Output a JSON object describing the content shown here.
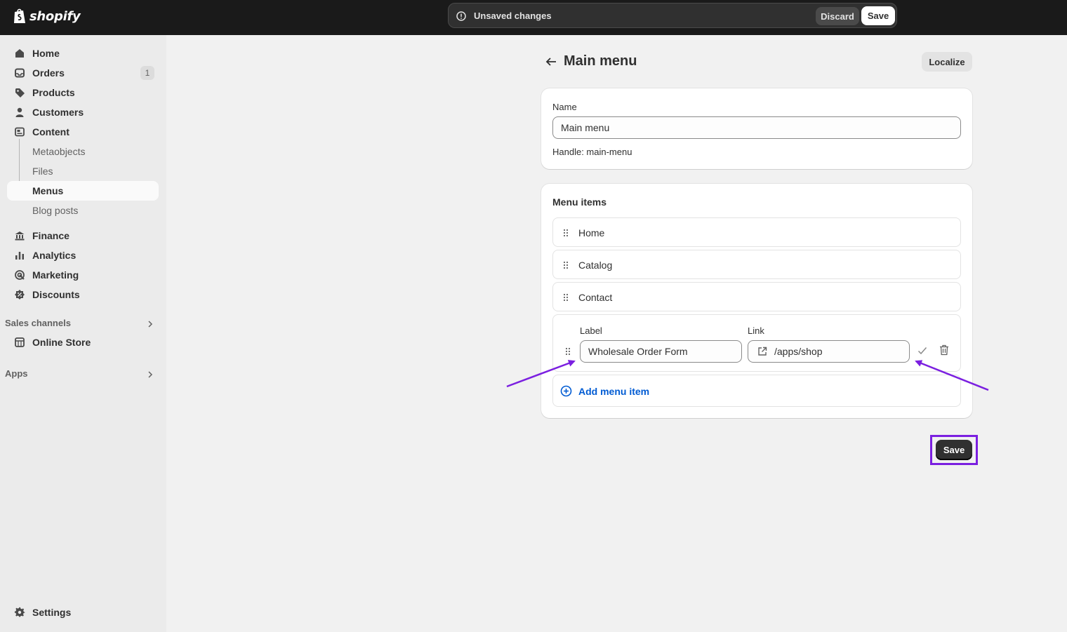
{
  "topbar": {
    "brand": "shopify",
    "unsaved_text": "Unsaved changes",
    "discard_label": "Discard",
    "save_label": "Save"
  },
  "sidebar": {
    "items": [
      {
        "label": "Home",
        "icon": "home-icon"
      },
      {
        "label": "Orders",
        "icon": "orders-icon",
        "badge": "1"
      },
      {
        "label": "Products",
        "icon": "tag-icon"
      },
      {
        "label": "Customers",
        "icon": "person-icon"
      },
      {
        "label": "Content",
        "icon": "content-icon"
      }
    ],
    "content_sub": [
      "Metaobjects",
      "Files",
      "Menus",
      "Blog posts"
    ],
    "items2": [
      {
        "label": "Finance",
        "icon": "bank-icon"
      },
      {
        "label": "Analytics",
        "icon": "bar-chart-icon"
      },
      {
        "label": "Marketing",
        "icon": "target-icon"
      },
      {
        "label": "Discounts",
        "icon": "discount-icon"
      }
    ],
    "sales_channels_label": "Sales channels",
    "online_store_label": "Online Store",
    "apps_label": "Apps",
    "settings_label": "Settings"
  },
  "page": {
    "title": "Main menu",
    "localize_label": "Localize"
  },
  "name_card": {
    "label": "Name",
    "value": "Main menu",
    "handle": "Handle: main-menu"
  },
  "menu_card": {
    "title": "Menu items",
    "items": [
      "Home",
      "Catalog",
      "Contact"
    ],
    "edit": {
      "label_title": "Label",
      "label_value": "Wholesale Order Form",
      "link_title": "Link",
      "link_value": "/apps/shop"
    },
    "add_label": "Add menu item"
  },
  "footer": {
    "save_label": "Save"
  },
  "colors": {
    "topbar": "#1a1a1a",
    "accent_link": "#005bd3",
    "annotation": "#7b1fe0"
  }
}
